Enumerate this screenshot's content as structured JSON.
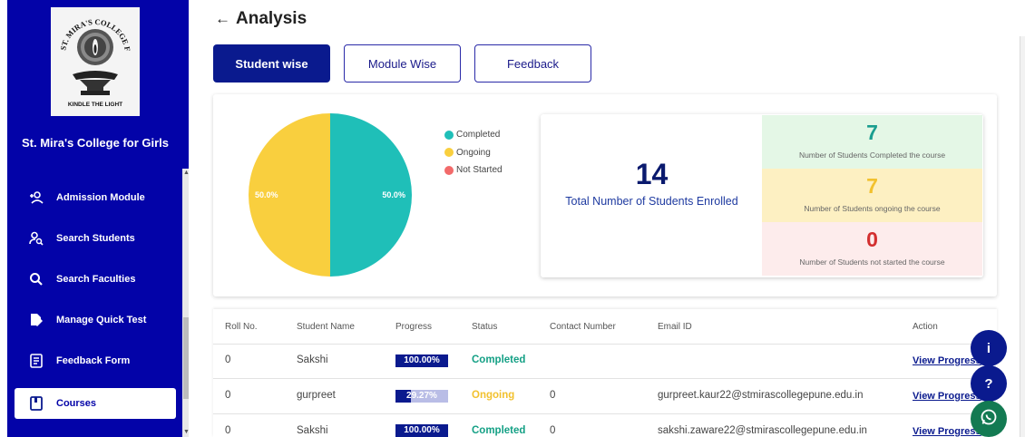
{
  "app": {
    "college_name": "St. Mira's College for Girls",
    "logo_motto": "KINDLE THE LIGHT",
    "logo_arc_text": "ST. MIRA'S COLLEGE FOR GIRLS"
  },
  "sidebar": {
    "items": [
      {
        "label": "Admission Module",
        "icon": "person-add-icon"
      },
      {
        "label": "Search Students",
        "icon": "person-search-icon"
      },
      {
        "label": "Search Faculties",
        "icon": "search-icon"
      },
      {
        "label": "Manage Quick Test",
        "icon": "edit-doc-icon"
      },
      {
        "label": "Feedback Form",
        "icon": "form-icon"
      },
      {
        "label": "Courses",
        "icon": "book-icon",
        "active": true
      }
    ]
  },
  "header": {
    "back_arrow": "←",
    "title": "Analysis"
  },
  "tabs": [
    {
      "label": "Student wise",
      "active": true
    },
    {
      "label": "Module Wise",
      "active": false
    },
    {
      "label": "Feedback",
      "active": false
    }
  ],
  "chart_data": {
    "type": "pie",
    "slices": [
      {
        "name": "Completed",
        "value": 50.0,
        "label": "50.0%",
        "color": "#1fbfb8"
      },
      {
        "name": "Ongoing",
        "value": 50.0,
        "label": "50.0%",
        "color": "#f9cf3e"
      },
      {
        "name": "Not Started",
        "value": 0.0,
        "label": "",
        "color": "#f26a6a"
      }
    ],
    "legend_placement": "right"
  },
  "summary": {
    "total_students": "14",
    "total_label": "Total Number of Students Enrolled",
    "completed_count": "7",
    "completed_label": "Number of Students Completed the course",
    "ongoing_count": "7",
    "ongoing_label": "Number of Students ongoing the course",
    "not_started_count": "0",
    "not_started_label": "Number of Students not started the course",
    "colors": {
      "completed_bg": "#e4f7e6",
      "completed_text": "#1a9e8f",
      "ongoing_bg": "#fdf0c2",
      "ongoing_text": "#f2c12e",
      "not_started_bg": "#fdecec",
      "not_started_text": "#d32f2f"
    }
  },
  "table": {
    "headers": {
      "roll": "Roll No.",
      "name": "Student Name",
      "progress": "Progress",
      "status": "Status",
      "contact": "Contact Number",
      "email": "Email ID",
      "action": "Action"
    },
    "rows": [
      {
        "roll": "0",
        "name": "Sakshi",
        "progress": "100.00%",
        "progress_value": 1.0,
        "status": "Completed",
        "contact": "",
        "email": "",
        "action": "View Progress"
      },
      {
        "roll": "0",
        "name": "gurpreet",
        "progress": "29.27%",
        "progress_value": 0.2927,
        "status": "Ongoing",
        "contact": "0",
        "email": "gurpreet.kaur22@stmirascollegepune.edu.in",
        "action": "View Progress"
      },
      {
        "roll": "0",
        "name": "Sakshi",
        "progress": "100.00%",
        "progress_value": 1.0,
        "status": "Completed",
        "contact": "0",
        "email": "sakshi.zaware22@stmirascollegepune.edu.in",
        "action": "View Progress"
      }
    ],
    "status_colors": {
      "Completed": "#14a085",
      "Ongoing": "#f2c12e"
    }
  },
  "fabs": [
    {
      "label": "i",
      "icon": "info-icon"
    },
    {
      "label": "?",
      "icon": "help-icon"
    },
    {
      "label": "",
      "icon": "whatsapp-icon"
    }
  ]
}
